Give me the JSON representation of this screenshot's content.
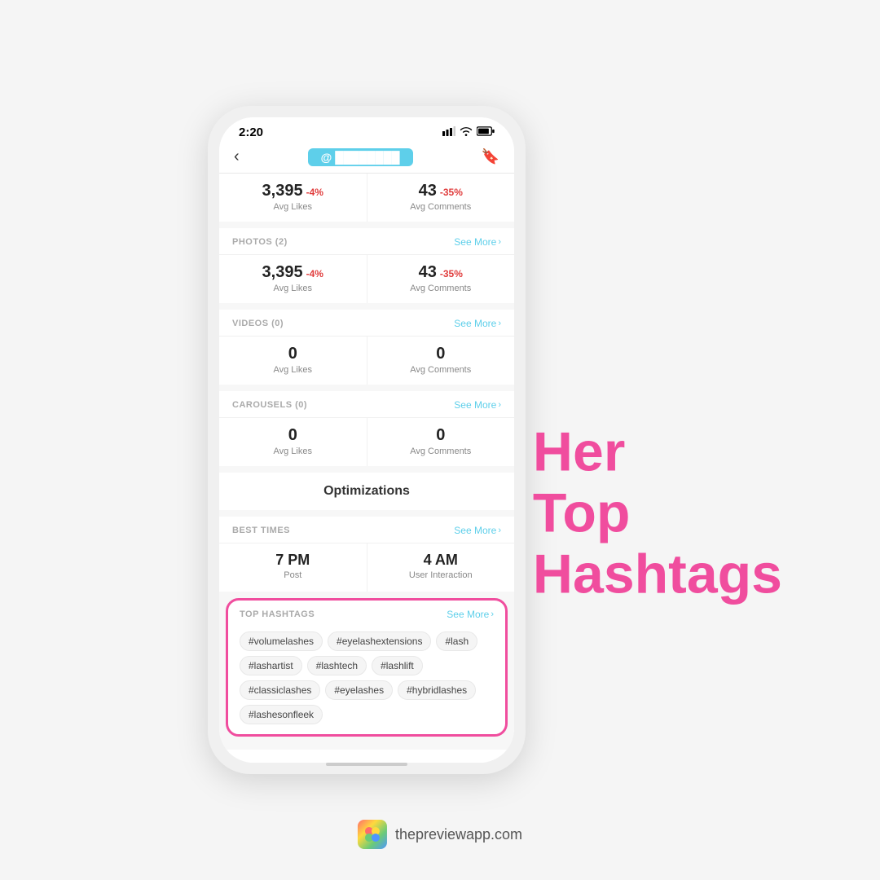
{
  "page": {
    "background_color": "#f5f5f5"
  },
  "status_bar": {
    "time": "2:20",
    "signal": "▲▲▲",
    "wifi": "wifi",
    "battery": "battery"
  },
  "nav": {
    "back_label": "‹",
    "username_placeholder": "@ ████████",
    "bookmark_label": "🔖"
  },
  "top_stats": {
    "avg_likes_value": "3,395",
    "avg_likes_change": "-4%",
    "avg_likes_label": "Avg Likes",
    "avg_comments_value": "43",
    "avg_comments_change": "-35%",
    "avg_comments_label": "Avg Comments"
  },
  "sections": [
    {
      "id": "photos",
      "title": "PHOTOS (2)",
      "see_more_label": "See More",
      "avg_likes_value": "3,395",
      "avg_likes_change": "-4%",
      "avg_likes_label": "Avg Likes",
      "avg_comments_value": "43",
      "avg_comments_change": "-35%",
      "avg_comments_label": "Avg Comments"
    },
    {
      "id": "videos",
      "title": "VIDEOS (0)",
      "see_more_label": "See More",
      "avg_likes_value": "0",
      "avg_likes_change": "",
      "avg_likes_label": "Avg Likes",
      "avg_comments_value": "0",
      "avg_comments_change": "",
      "avg_comments_label": "Avg Comments"
    },
    {
      "id": "carousels",
      "title": "CAROUSELS (0)",
      "see_more_label": "See More",
      "avg_likes_value": "0",
      "avg_likes_change": "",
      "avg_likes_label": "Avg Likes",
      "avg_comments_value": "0",
      "avg_comments_change": "",
      "avg_comments_label": "Avg Comments"
    }
  ],
  "optimizations": {
    "title": "Optimizations"
  },
  "best_times": {
    "section_title": "BEST TIMES",
    "see_more_label": "See More",
    "post_time": "7 PM",
    "post_label": "Post",
    "interaction_time": "4 AM",
    "interaction_label": "User Interaction"
  },
  "top_hashtags": {
    "section_title": "TOP HASHTAGS",
    "see_more_label": "See More",
    "tags": [
      "#volumelashes",
      "#eyelashextensions",
      "#lash",
      "#lashartist",
      "#lashtech",
      "#lashlift",
      "#classiclashes",
      "#eyelashes",
      "#hybridlashes",
      "#lashesonfleek"
    ]
  },
  "right_text": {
    "line1": "Her",
    "line2": "Top",
    "line3": "Hashtags"
  },
  "branding": {
    "logo_emoji": "◉",
    "website": "thepreviewapp.com"
  }
}
